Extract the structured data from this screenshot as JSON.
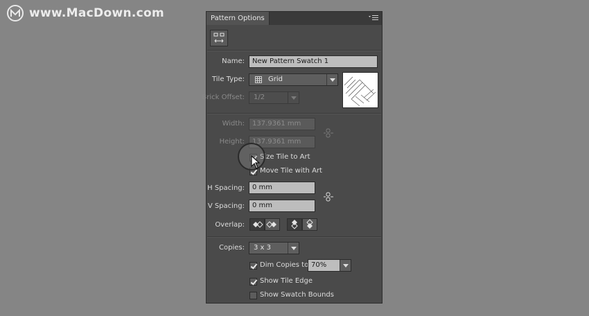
{
  "watermark": {
    "text": "www.MacDown.com",
    "logo_icon": "macdown-logo-icon"
  },
  "panel": {
    "title": "Pattern Options",
    "menu_icon": "panel-menu-icon",
    "tool_icon": "pattern-tile-tool-icon",
    "name": {
      "label": "Name:",
      "value": "New Pattern Swatch 1"
    },
    "tile_type": {
      "label": "Tile Type:",
      "value": "Grid",
      "icon": "grid-icon"
    },
    "brick_offset": {
      "label": "Brick Offset:",
      "value": "1/2",
      "disabled": true
    },
    "width": {
      "label": "Width:",
      "value": "137.9361 mm"
    },
    "height": {
      "label": "Height:",
      "value": "137.9361 mm"
    },
    "size_tile_to_art": {
      "label": "Size Tile to Art",
      "checked": true
    },
    "move_tile_with_art": {
      "label": "Move Tile with Art",
      "checked": true
    },
    "h_spacing": {
      "label": "H Spacing:",
      "value": "0 mm"
    },
    "v_spacing": {
      "label": "V Spacing:",
      "value": "0 mm"
    },
    "overlap": {
      "label": "Overlap:"
    },
    "copies": {
      "label": "Copies:",
      "value": "3 x 3"
    },
    "dim_copies": {
      "label": "Dim Copies to:",
      "checked": true,
      "value": "70%"
    },
    "show_tile_edge": {
      "label": "Show Tile Edge",
      "checked": true
    },
    "show_swatch_bounds": {
      "label": "Show Swatch Bounds",
      "checked": false
    }
  },
  "colors": {
    "panel_bg": "#4a4a4a",
    "page_bg": "#858585",
    "field_bg": "#bdbdbd"
  }
}
